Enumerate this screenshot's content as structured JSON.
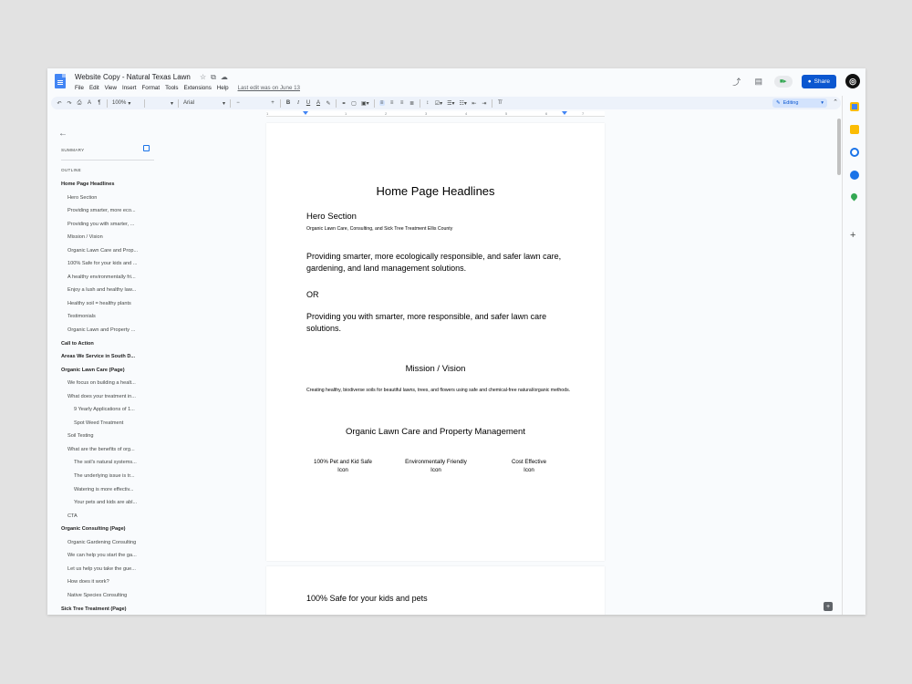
{
  "window": {
    "doc_title": "Website Copy - Natural Texas Lawn",
    "menus": [
      "File",
      "Edit",
      "View",
      "Insert",
      "Format",
      "Tools",
      "Extensions",
      "Help"
    ],
    "last_edit": "Last edit was on June 13",
    "share_label": "Share"
  },
  "toolbar": {
    "zoom": "100%",
    "font": "Arial",
    "font_size": "",
    "bold": "B",
    "italic": "I",
    "underline": "U",
    "mode": "Editing"
  },
  "ruler": {
    "ticks": [
      "1",
      "1",
      "2",
      "3",
      "4",
      "5",
      "6",
      "7"
    ]
  },
  "outline": {
    "summary_label": "SUMMARY",
    "outline_label": "OUTLINE",
    "items": [
      {
        "label": "Home Page Headlines",
        "level": 1
      },
      {
        "label": "Hero Section",
        "level": 2
      },
      {
        "label": "Providing smarter, more eco...",
        "level": 2
      },
      {
        "label": "Providing you with smarter, ...",
        "level": 2
      },
      {
        "label": "Mission / Vision",
        "level": 2
      },
      {
        "label": "Organic Lawn Care and Prop...",
        "level": 2
      },
      {
        "label": "100% Safe for your kids and ...",
        "level": 2
      },
      {
        "label": "A healthy environmentally fri...",
        "level": 2
      },
      {
        "label": "Enjoy a lush and healthy law...",
        "level": 2
      },
      {
        "label": "Healthy soil = healthy plants",
        "level": 2
      },
      {
        "label": "Testimonials",
        "level": 2
      },
      {
        "label": "Organic Lawn and Property ...",
        "level": 2
      },
      {
        "label": "Call to Action",
        "level": 1
      },
      {
        "label": "Areas We Service in South D...",
        "level": 1
      },
      {
        "label": "Organic Lawn Care (Page)",
        "level": 1
      },
      {
        "label": "We focus on building a healt...",
        "level": 2
      },
      {
        "label": "What does your treatment in...",
        "level": 2
      },
      {
        "label": "9 Yearly Applications of 1...",
        "level": 3
      },
      {
        "label": "Spot Weed Treatment",
        "level": 3
      },
      {
        "label": "Soil Testing",
        "level": 2
      },
      {
        "label": "What are the benefits of org...",
        "level": 2
      },
      {
        "label": "The soil's natural systems...",
        "level": 3
      },
      {
        "label": "The underlying issue is tr...",
        "level": 3
      },
      {
        "label": "Watering is more effectiv...",
        "level": 3
      },
      {
        "label": "Your pets and kids are abl...",
        "level": 3
      },
      {
        "label": "CTA",
        "level": 2
      },
      {
        "label": "Organic Consulting (Page)",
        "level": 1
      },
      {
        "label": "Organic Gardening Consulting",
        "level": 2
      },
      {
        "label": "We can help you start the ga...",
        "level": 2
      },
      {
        "label": "Let us help you take the gue...",
        "level": 2
      },
      {
        "label": "How does it work?",
        "level": 2
      },
      {
        "label": "Native Species Consulting",
        "level": 2
      },
      {
        "label": "Sick Tree Treatment (Page)",
        "level": 1
      }
    ]
  },
  "document": {
    "page1": {
      "main_heading": "Home Page Headlines",
      "hero_heading": "Hero Section",
      "hero_sub": "Organic Lawn Care, Consulting, and Sick Tree Treatment Ellis County",
      "para1": "Providing smarter, more ecologically responsible, and safer lawn care, gardening, and land management solutions.",
      "or": "OR",
      "para2": "Providing you with smarter, more responsible, and safer lawn care solutions.",
      "mission_heading": "Mission / Vision",
      "mission_text": "Creating healthy, biodiverse soils for beautiful lawns, trees, and flowers using safe and chemical-free natural/organic methods.",
      "org_heading": "Organic Lawn Care and Property Management",
      "columns": [
        {
          "title": "100% Pet and Kid Safe",
          "sub": "Icon"
        },
        {
          "title": "Environmentally Friendly",
          "sub": "Icon"
        },
        {
          "title": "Cost Effective",
          "sub": "Icon"
        }
      ]
    },
    "page2": {
      "heading": "100% Safe for your kids and pets"
    }
  }
}
